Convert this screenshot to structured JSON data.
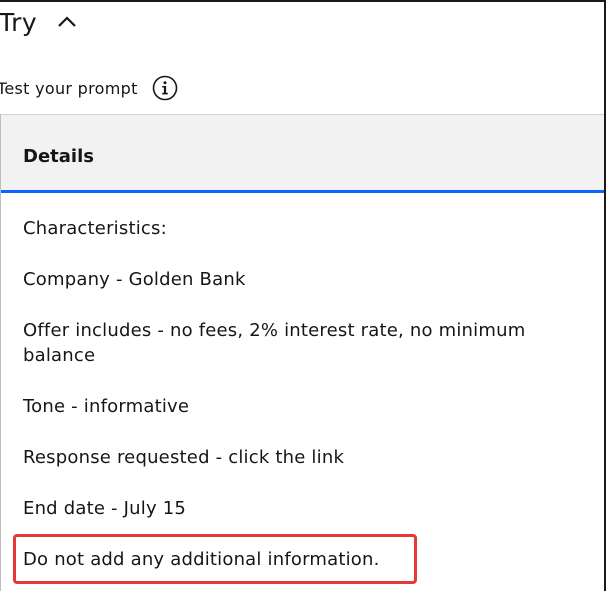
{
  "header": {
    "title": "Try",
    "subtitle": "Test your prompt"
  },
  "panel": {
    "tab_label": "Details"
  },
  "content": {
    "lines": [
      "Characteristics:",
      "Company - Golden Bank",
      "Offer includes - no fees, 2% interest rate, no minimum balance",
      "Tone - informative",
      "Response requested - click the link",
      "End date - July 15",
      "Do not add any additional information."
    ]
  },
  "icons": {
    "collapse": "chevron-up-icon",
    "info": "info-icon"
  },
  "colors": {
    "accent": "#0f62fe",
    "highlight": "#e53935",
    "panel_bg": "#f2f2f2"
  }
}
